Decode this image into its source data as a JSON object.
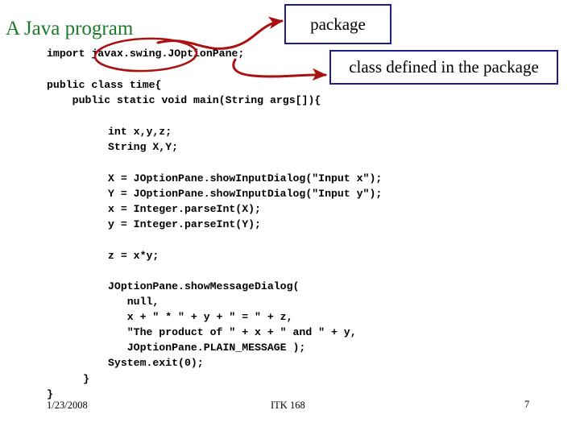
{
  "slide": {
    "title": "A Java program"
  },
  "code": {
    "import_line": "import javax.swing.JOptionPane;",
    "class_header": "public class time{\n    public static void main(String args[]){",
    "declarations": "int x,y,z;\nString X,Y;",
    "input_lines": "X = JOptionPane.showInputDialog(\"Input x\");\nY = JOptionPane.showInputDialog(\"Input y\");\nx = Integer.parseInt(X);\ny = Integer.parseInt(Y);",
    "product_line": "z = x*y;",
    "dialog_block": "JOptionPane.showMessageDialog(\n   null,\n   x + \" * \" + y + \" = \" + z,\n   \"The product of \" + x + \" and \" + y,\n   JOptionPane.PLAIN_MESSAGE );\nSystem.exit(0);",
    "close_inner": "}",
    "close_outer": "}"
  },
  "callouts": {
    "package": "package",
    "class_in_package": "class defined in the package"
  },
  "annotations": {
    "ellipse_target": "javax.swing.",
    "arrow_to_package": "arrow-package",
    "arrow_to_class": "arrow-class",
    "accent_color": "#aa1111",
    "box_border_color": "#1c1c8c",
    "title_color": "#1a7a2a"
  },
  "footer": {
    "date": "1/23/2008",
    "course": "ITK 168",
    "page": "7"
  }
}
